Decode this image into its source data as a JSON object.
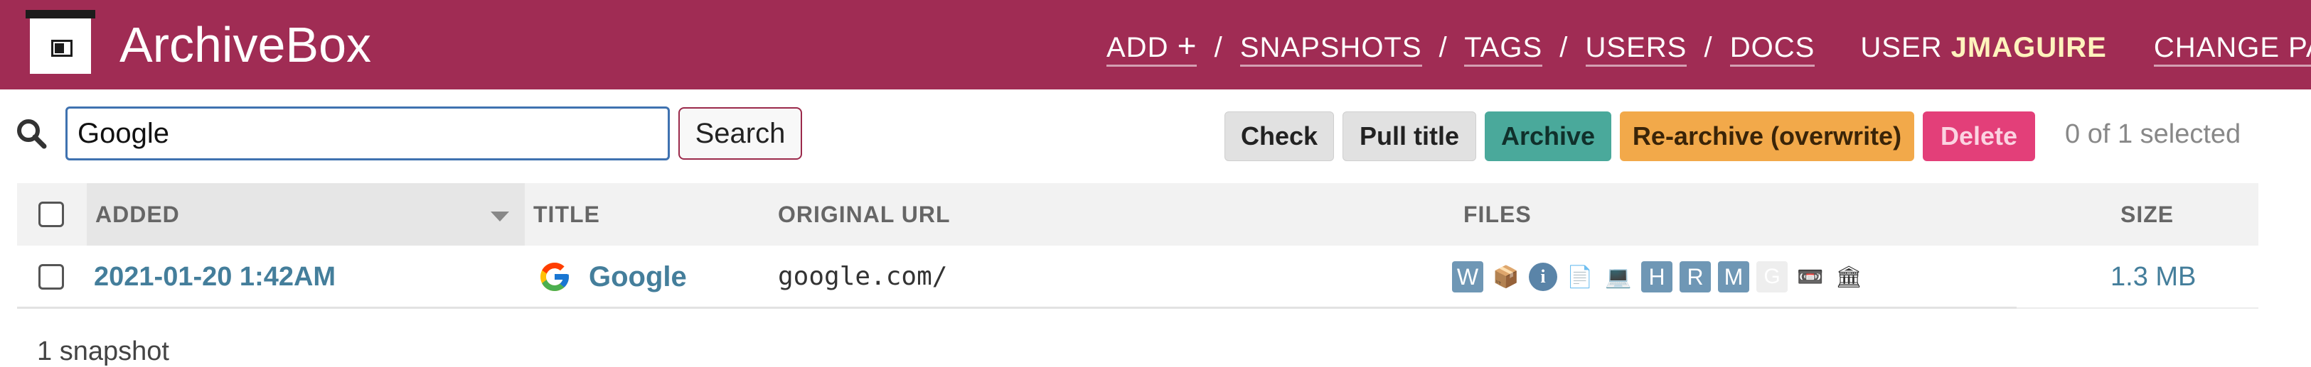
{
  "header": {
    "brand": "ArchiveBox",
    "nav": {
      "add": "ADD",
      "add_plus": "+",
      "snapshots": "SNAPSHOTS",
      "tags": "TAGS",
      "users": "USERS",
      "docs": "DOCS",
      "separator": "/",
      "user_label": "USER",
      "username": "JMAGUIRE",
      "change_password": "CHANGE PASSWORD /"
    },
    "colors": {
      "background": "#a02c54",
      "username": "#fff3bd"
    }
  },
  "toolbar": {
    "search_value": "Google",
    "search_button": "Search",
    "actions": {
      "check": "Check",
      "pull_title": "Pull title",
      "archive": "Archive",
      "rearchive": "Re-archive (overwrite)",
      "delete": "Delete"
    },
    "selected_count": "0 of 1 selected",
    "colors": {
      "archive": "#4aa99b",
      "rearchive": "#f2a94a",
      "delete": "#e33f79"
    }
  },
  "table": {
    "columns": {
      "added": "ADDED",
      "title": "TITLE",
      "original_url": "ORIGINAL URL",
      "files": "FILES",
      "size": "SIZE"
    },
    "rows": [
      {
        "added": "2021-01-20 1:42AM",
        "title": "Google",
        "favicon": "google-logo-icon",
        "original_url": "google.com/",
        "files": [
          {
            "name": "wget-icon",
            "glyph": "W"
          },
          {
            "name": "archive-package-icon",
            "glyph": "📦"
          },
          {
            "name": "info-icon",
            "glyph": "i"
          },
          {
            "name": "document-icon",
            "glyph": "📄"
          },
          {
            "name": "screenshot-icon",
            "glyph": "💻"
          },
          {
            "name": "html-icon",
            "glyph": "H"
          },
          {
            "name": "readability-icon",
            "glyph": "R"
          },
          {
            "name": "mercury-icon",
            "glyph": "M"
          },
          {
            "name": "git-icon",
            "glyph": "G"
          },
          {
            "name": "media-tape-icon",
            "glyph": "📼"
          },
          {
            "name": "archive-org-icon",
            "glyph": "🏛"
          }
        ],
        "size": "1.3 MB"
      }
    ]
  },
  "footer": {
    "count": "1 snapshot"
  }
}
